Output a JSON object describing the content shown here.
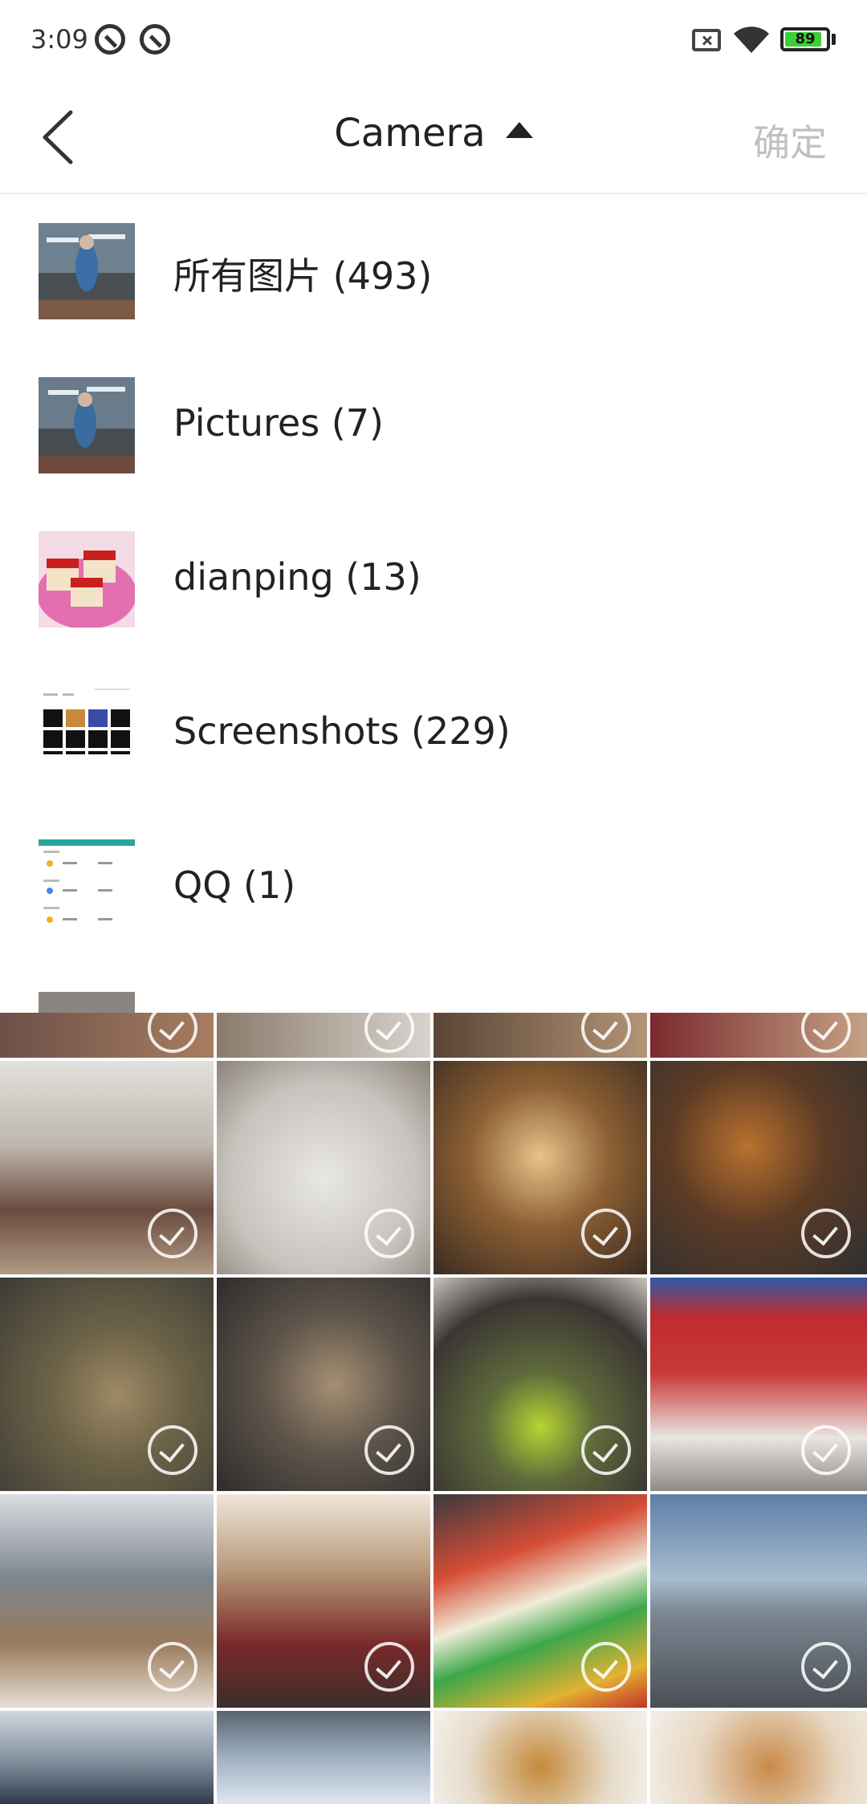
{
  "status_bar": {
    "time": "3:09",
    "battery": "89",
    "battery_level_percent": 89,
    "icons": [
      "app-notification-icon",
      "app-notification-icon",
      "sim-missing-icon",
      "wifi-icon",
      "battery-icon"
    ]
  },
  "header": {
    "back_icon": "back-arrow-icon",
    "title": "Camera",
    "dropdown_icon": "caret-up-icon",
    "confirm_label": "确定"
  },
  "albums": [
    {
      "label": "所有图片 (493)"
    },
    {
      "label": "Pictures (7)"
    },
    {
      "label": "dianping (13)"
    },
    {
      "label": "Screenshots (229)"
    },
    {
      "label": "QQ (1)"
    }
  ],
  "colors": {
    "confirm_disabled": "#c0c0c0",
    "battery_green": "#3bd039",
    "divider": "#eeeeee"
  }
}
